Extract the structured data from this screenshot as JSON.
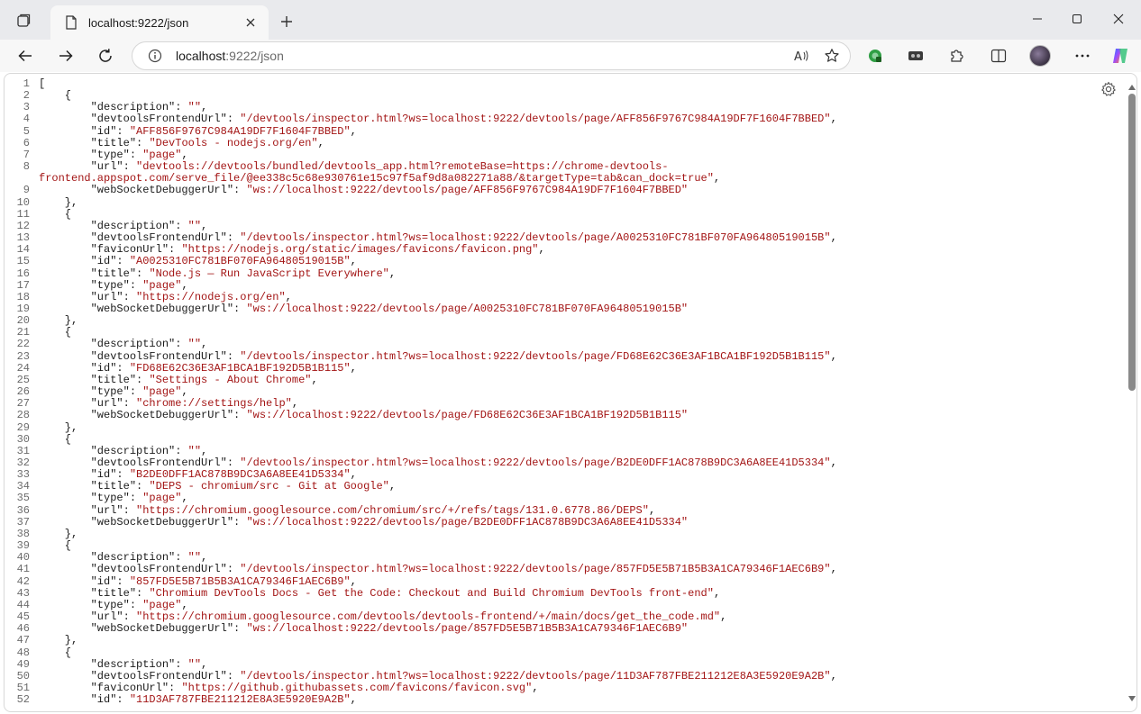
{
  "tab": {
    "title": "localhost:9222/json"
  },
  "address": {
    "host": "localhost",
    "rest": ":9222/json"
  },
  "colors": {
    "string": "#a31515",
    "punct": "#1b1b1b",
    "line_number": "#6b6b6b"
  },
  "icons": [
    "tab-actions-icon",
    "page-icon",
    "close-icon",
    "plus-icon",
    "minimize-icon",
    "maximize-icon",
    "window-close-icon",
    "back-icon",
    "forward-icon",
    "refresh-icon",
    "info-icon",
    "read-aloud-icon",
    "favorite-star-icon",
    "extension-green-icon",
    "extension-dark-icon",
    "extensions-puzzle-icon",
    "split-screen-icon",
    "profile-avatar",
    "more-dots-icon",
    "copilot-icon",
    "settings-gear-icon"
  ],
  "code_lines": [
    [
      [
        "[",
        "p"
      ]
    ],
    [
      [
        "    {",
        "p"
      ]
    ],
    [
      [
        "        ",
        "p"
      ],
      [
        "\"description\"",
        "p"
      ],
      [
        ": ",
        "p"
      ],
      [
        "\"\"",
        "s"
      ],
      [
        ",",
        "p"
      ]
    ],
    [
      [
        "        ",
        "p"
      ],
      [
        "\"devtoolsFrontendUrl\"",
        "p"
      ],
      [
        ": ",
        "p"
      ],
      [
        "\"/devtools/inspector.html?ws=localhost:9222/devtools/page/AFF856F9767C984A19DF7F1604F7BBED\"",
        "s"
      ],
      [
        ",",
        "p"
      ]
    ],
    [
      [
        "        ",
        "p"
      ],
      [
        "\"id\"",
        "p"
      ],
      [
        ": ",
        "p"
      ],
      [
        "\"AFF856F9767C984A19DF7F1604F7BBED\"",
        "s"
      ],
      [
        ",",
        "p"
      ]
    ],
    [
      [
        "        ",
        "p"
      ],
      [
        "\"title\"",
        "p"
      ],
      [
        ": ",
        "p"
      ],
      [
        "\"DevTools - nodejs.org/en\"",
        "s"
      ],
      [
        ",",
        "p"
      ]
    ],
    [
      [
        "        ",
        "p"
      ],
      [
        "\"type\"",
        "p"
      ],
      [
        ": ",
        "p"
      ],
      [
        "\"page\"",
        "s"
      ],
      [
        ",",
        "p"
      ]
    ],
    [
      [
        "        ",
        "p"
      ],
      [
        "\"url\"",
        "p"
      ],
      [
        ": ",
        "p"
      ],
      [
        "\"devtools://devtools/bundled/devtools_app.html?remoteBase=https://chrome-devtools-",
        "s"
      ]
    ],
    [
      [
        "frontend.appspot.com/serve_file/@ee338c5c68e930761e15c97f5af9d8a082271a88/&targetType=tab&can_dock=true\"",
        "s"
      ],
      [
        ",",
        "p"
      ]
    ],
    [
      [
        "        ",
        "p"
      ],
      [
        "\"webSocketDebuggerUrl\"",
        "p"
      ],
      [
        ": ",
        "p"
      ],
      [
        "\"ws://localhost:9222/devtools/page/AFF856F9767C984A19DF7F1604F7BBED\"",
        "s"
      ]
    ],
    [
      [
        "    },",
        "p"
      ]
    ],
    [
      [
        "    {",
        "p"
      ]
    ],
    [
      [
        "        ",
        "p"
      ],
      [
        "\"description\"",
        "p"
      ],
      [
        ": ",
        "p"
      ],
      [
        "\"\"",
        "s"
      ],
      [
        ",",
        "p"
      ]
    ],
    [
      [
        "        ",
        "p"
      ],
      [
        "\"devtoolsFrontendUrl\"",
        "p"
      ],
      [
        ": ",
        "p"
      ],
      [
        "\"/devtools/inspector.html?ws=localhost:9222/devtools/page/A0025310FC781BF070FA96480519015B\"",
        "s"
      ],
      [
        ",",
        "p"
      ]
    ],
    [
      [
        "        ",
        "p"
      ],
      [
        "\"faviconUrl\"",
        "p"
      ],
      [
        ": ",
        "p"
      ],
      [
        "\"https://nodejs.org/static/images/favicons/favicon.png\"",
        "s"
      ],
      [
        ",",
        "p"
      ]
    ],
    [
      [
        "        ",
        "p"
      ],
      [
        "\"id\"",
        "p"
      ],
      [
        ": ",
        "p"
      ],
      [
        "\"A0025310FC781BF070FA96480519015B\"",
        "s"
      ],
      [
        ",",
        "p"
      ]
    ],
    [
      [
        "        ",
        "p"
      ],
      [
        "\"title\"",
        "p"
      ],
      [
        ": ",
        "p"
      ],
      [
        "\"Node.js — Run JavaScript Everywhere\"",
        "s"
      ],
      [
        ",",
        "p"
      ]
    ],
    [
      [
        "        ",
        "p"
      ],
      [
        "\"type\"",
        "p"
      ],
      [
        ": ",
        "p"
      ],
      [
        "\"page\"",
        "s"
      ],
      [
        ",",
        "p"
      ]
    ],
    [
      [
        "        ",
        "p"
      ],
      [
        "\"url\"",
        "p"
      ],
      [
        ": ",
        "p"
      ],
      [
        "\"https://nodejs.org/en\"",
        "s"
      ],
      [
        ",",
        "p"
      ]
    ],
    [
      [
        "        ",
        "p"
      ],
      [
        "\"webSocketDebuggerUrl\"",
        "p"
      ],
      [
        ": ",
        "p"
      ],
      [
        "\"ws://localhost:9222/devtools/page/A0025310FC781BF070FA96480519015B\"",
        "s"
      ]
    ],
    [
      [
        "    },",
        "p"
      ]
    ],
    [
      [
        "    {",
        "p"
      ]
    ],
    [
      [
        "        ",
        "p"
      ],
      [
        "\"description\"",
        "p"
      ],
      [
        ": ",
        "p"
      ],
      [
        "\"\"",
        "s"
      ],
      [
        ",",
        "p"
      ]
    ],
    [
      [
        "        ",
        "p"
      ],
      [
        "\"devtoolsFrontendUrl\"",
        "p"
      ],
      [
        ": ",
        "p"
      ],
      [
        "\"/devtools/inspector.html?ws=localhost:9222/devtools/page/FD68E62C36E3AF1BCA1BF192D5B1B115\"",
        "s"
      ],
      [
        ",",
        "p"
      ]
    ],
    [
      [
        "        ",
        "p"
      ],
      [
        "\"id\"",
        "p"
      ],
      [
        ": ",
        "p"
      ],
      [
        "\"FD68E62C36E3AF1BCA1BF192D5B1B115\"",
        "s"
      ],
      [
        ",",
        "p"
      ]
    ],
    [
      [
        "        ",
        "p"
      ],
      [
        "\"title\"",
        "p"
      ],
      [
        ": ",
        "p"
      ],
      [
        "\"Settings - About Chrome\"",
        "s"
      ],
      [
        ",",
        "p"
      ]
    ],
    [
      [
        "        ",
        "p"
      ],
      [
        "\"type\"",
        "p"
      ],
      [
        ": ",
        "p"
      ],
      [
        "\"page\"",
        "s"
      ],
      [
        ",",
        "p"
      ]
    ],
    [
      [
        "        ",
        "p"
      ],
      [
        "\"url\"",
        "p"
      ],
      [
        ": ",
        "p"
      ],
      [
        "\"chrome://settings/help\"",
        "s"
      ],
      [
        ",",
        "p"
      ]
    ],
    [
      [
        "        ",
        "p"
      ],
      [
        "\"webSocketDebuggerUrl\"",
        "p"
      ],
      [
        ": ",
        "p"
      ],
      [
        "\"ws://localhost:9222/devtools/page/FD68E62C36E3AF1BCA1BF192D5B1B115\"",
        "s"
      ]
    ],
    [
      [
        "    },",
        "p"
      ]
    ],
    [
      [
        "    {",
        "p"
      ]
    ],
    [
      [
        "        ",
        "p"
      ],
      [
        "\"description\"",
        "p"
      ],
      [
        ": ",
        "p"
      ],
      [
        "\"\"",
        "s"
      ],
      [
        ",",
        "p"
      ]
    ],
    [
      [
        "        ",
        "p"
      ],
      [
        "\"devtoolsFrontendUrl\"",
        "p"
      ],
      [
        ": ",
        "p"
      ],
      [
        "\"/devtools/inspector.html?ws=localhost:9222/devtools/page/B2DE0DFF1AC878B9DC3A6A8EE41D5334\"",
        "s"
      ],
      [
        ",",
        "p"
      ]
    ],
    [
      [
        "        ",
        "p"
      ],
      [
        "\"id\"",
        "p"
      ],
      [
        ": ",
        "p"
      ],
      [
        "\"B2DE0DFF1AC878B9DC3A6A8EE41D5334\"",
        "s"
      ],
      [
        ",",
        "p"
      ]
    ],
    [
      [
        "        ",
        "p"
      ],
      [
        "\"title\"",
        "p"
      ],
      [
        ": ",
        "p"
      ],
      [
        "\"DEPS - chromium/src - Git at Google\"",
        "s"
      ],
      [
        ",",
        "p"
      ]
    ],
    [
      [
        "        ",
        "p"
      ],
      [
        "\"type\"",
        "p"
      ],
      [
        ": ",
        "p"
      ],
      [
        "\"page\"",
        "s"
      ],
      [
        ",",
        "p"
      ]
    ],
    [
      [
        "        ",
        "p"
      ],
      [
        "\"url\"",
        "p"
      ],
      [
        ": ",
        "p"
      ],
      [
        "\"https://chromium.googlesource.com/chromium/src/+/refs/tags/131.0.6778.86/DEPS\"",
        "s"
      ],
      [
        ",",
        "p"
      ]
    ],
    [
      [
        "        ",
        "p"
      ],
      [
        "\"webSocketDebuggerUrl\"",
        "p"
      ],
      [
        ": ",
        "p"
      ],
      [
        "\"ws://localhost:9222/devtools/page/B2DE0DFF1AC878B9DC3A6A8EE41D5334\"",
        "s"
      ]
    ],
    [
      [
        "    },",
        "p"
      ]
    ],
    [
      [
        "    {",
        "p"
      ]
    ],
    [
      [
        "        ",
        "p"
      ],
      [
        "\"description\"",
        "p"
      ],
      [
        ": ",
        "p"
      ],
      [
        "\"\"",
        "s"
      ],
      [
        ",",
        "p"
      ]
    ],
    [
      [
        "        ",
        "p"
      ],
      [
        "\"devtoolsFrontendUrl\"",
        "p"
      ],
      [
        ": ",
        "p"
      ],
      [
        "\"/devtools/inspector.html?ws=localhost:9222/devtools/page/857FD5E5B71B5B3A1CA79346F1AEC6B9\"",
        "s"
      ],
      [
        ",",
        "p"
      ]
    ],
    [
      [
        "        ",
        "p"
      ],
      [
        "\"id\"",
        "p"
      ],
      [
        ": ",
        "p"
      ],
      [
        "\"857FD5E5B71B5B3A1CA79346F1AEC6B9\"",
        "s"
      ],
      [
        ",",
        "p"
      ]
    ],
    [
      [
        "        ",
        "p"
      ],
      [
        "\"title\"",
        "p"
      ],
      [
        ": ",
        "p"
      ],
      [
        "\"Chromium DevTools Docs - Get the Code: Checkout and Build Chromium DevTools front-end\"",
        "s"
      ],
      [
        ",",
        "p"
      ]
    ],
    [
      [
        "        ",
        "p"
      ],
      [
        "\"type\"",
        "p"
      ],
      [
        ": ",
        "p"
      ],
      [
        "\"page\"",
        "s"
      ],
      [
        ",",
        "p"
      ]
    ],
    [
      [
        "        ",
        "p"
      ],
      [
        "\"url\"",
        "p"
      ],
      [
        ": ",
        "p"
      ],
      [
        "\"https://chromium.googlesource.com/devtools/devtools-frontend/+/main/docs/get_the_code.md\"",
        "s"
      ],
      [
        ",",
        "p"
      ]
    ],
    [
      [
        "        ",
        "p"
      ],
      [
        "\"webSocketDebuggerUrl\"",
        "p"
      ],
      [
        ": ",
        "p"
      ],
      [
        "\"ws://localhost:9222/devtools/page/857FD5E5B71B5B3A1CA79346F1AEC6B9\"",
        "s"
      ]
    ],
    [
      [
        "    },",
        "p"
      ]
    ],
    [
      [
        "    {",
        "p"
      ]
    ],
    [
      [
        "        ",
        "p"
      ],
      [
        "\"description\"",
        "p"
      ],
      [
        ": ",
        "p"
      ],
      [
        "\"\"",
        "s"
      ],
      [
        ",",
        "p"
      ]
    ],
    [
      [
        "        ",
        "p"
      ],
      [
        "\"devtoolsFrontendUrl\"",
        "p"
      ],
      [
        ": ",
        "p"
      ],
      [
        "\"/devtools/inspector.html?ws=localhost:9222/devtools/page/11D3AF787FBE211212E8A3E5920E9A2B\"",
        "s"
      ],
      [
        ",",
        "p"
      ]
    ],
    [
      [
        "        ",
        "p"
      ],
      [
        "\"faviconUrl\"",
        "p"
      ],
      [
        ": ",
        "p"
      ],
      [
        "\"https://github.githubassets.com/favicons/favicon.svg\"",
        "s"
      ],
      [
        ",",
        "p"
      ]
    ],
    [
      [
        "        ",
        "p"
      ],
      [
        "\"id\"",
        "p"
      ],
      [
        ": ",
        "p"
      ],
      [
        "\"11D3AF787FBE211212E8A3E5920E9A2B\"",
        "s"
      ],
      [
        ",",
        "p"
      ]
    ]
  ],
  "line_numbers": [
    "1",
    "2",
    "3",
    "4",
    "5",
    "6",
    "7",
    "8",
    "",
    "9",
    "10",
    "11",
    "12",
    "13",
    "14",
    "15",
    "16",
    "17",
    "18",
    "19",
    "20",
    "21",
    "22",
    "23",
    "24",
    "25",
    "26",
    "27",
    "28",
    "29",
    "30",
    "31",
    "32",
    "33",
    "34",
    "35",
    "36",
    "37",
    "38",
    "39",
    "40",
    "41",
    "42",
    "43",
    "44",
    "45",
    "46",
    "47",
    "48",
    "49",
    "50",
    "51",
    "52"
  ]
}
